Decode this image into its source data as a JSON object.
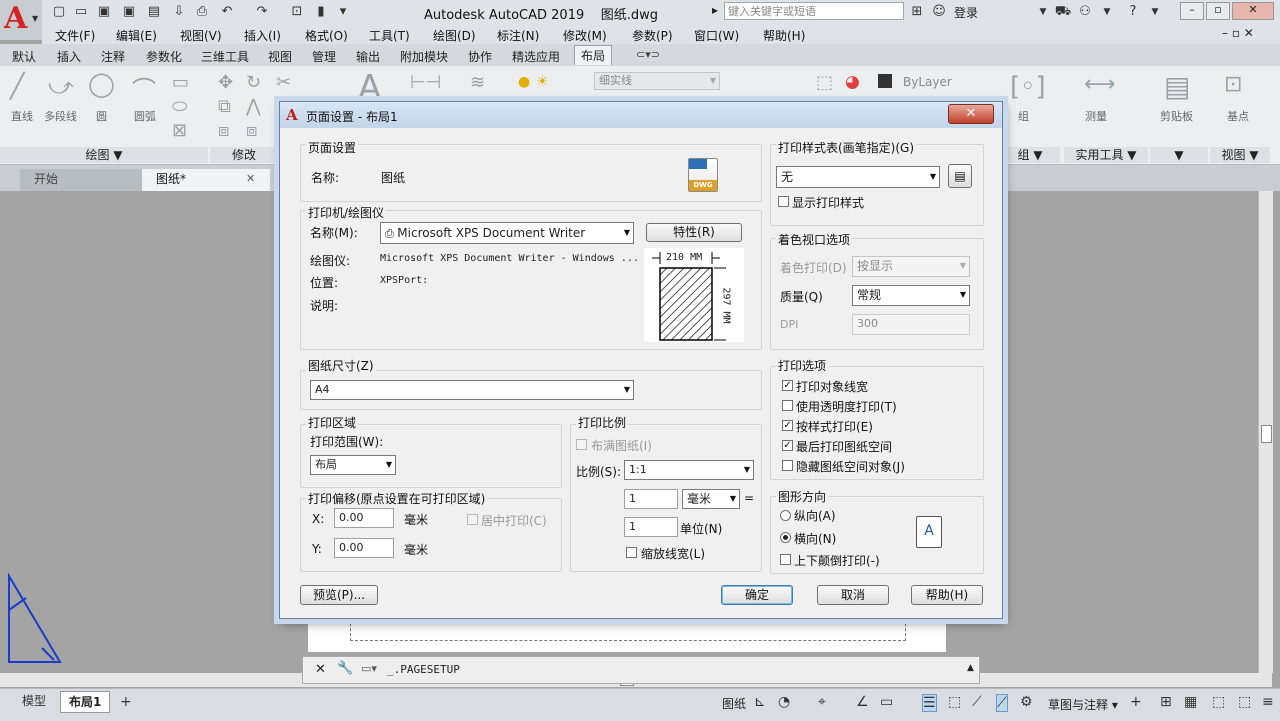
{
  "app": {
    "title": "Autodesk AutoCAD 2019",
    "filename": "图纸.dwg",
    "search_placeholder": "键入关键字或短语",
    "login_label": "登录"
  },
  "menus": [
    "文件(F)",
    "编辑(E)",
    "视图(V)",
    "插入(I)",
    "格式(O)",
    "工具(T)",
    "绘图(D)",
    "标注(N)",
    "修改(M)",
    "参数(P)",
    "窗口(W)",
    "帮助(H)"
  ],
  "ribbon_tabs": [
    "默认",
    "插入",
    "注释",
    "参数化",
    "三维工具",
    "视图",
    "管理",
    "输出",
    "附加模块",
    "协作",
    "精选应用",
    "布局"
  ],
  "active_ribbon_tab": "布局",
  "ribbon": {
    "tools": [
      "直线",
      "多段线",
      "圆",
      "圆弧"
    ],
    "panel_draw": "绘图",
    "panel_modify": "修改",
    "linetype": "细实线",
    "bylayer": "ByLayer",
    "group": "组",
    "measure": "测量",
    "clipboard": "剪贴板",
    "base": "基点",
    "panel_group": "组",
    "panel_utilities": "实用工具",
    "panel_view": "视图"
  },
  "doc_tabs": [
    {
      "label": "开始"
    },
    {
      "label": "图纸*"
    }
  ],
  "dialog": {
    "title": "页面设置 - 布局1",
    "page_setup": {
      "group": "页面设置",
      "name_label": "名称:",
      "name_value": "图纸",
      "dwg_icon_text": "DWG"
    },
    "printer": {
      "group": "打印机/绘图仪",
      "name_label": "名称(M):",
      "name_value": "Microsoft XPS Document Writer",
      "properties_button": "特性(R)",
      "plotter_label": "绘图仪:",
      "plotter_value": "Microsoft XPS Document Writer - Windows ...",
      "location_label": "位置:",
      "location_value": "XPSPort:",
      "description_label": "说明:",
      "preview_width": "210 MM",
      "preview_height": "297 MM"
    },
    "paper_size": {
      "group": "图纸尺寸(Z)",
      "value": "A4"
    },
    "plot_area": {
      "group": "打印区域",
      "range_label": "打印范围(W):",
      "range_value": "布局"
    },
    "plot_offset": {
      "group": "打印偏移(原点设置在可打印区域)",
      "x_label": "X:",
      "x_value": "0.00",
      "y_label": "Y:",
      "y_value": "0.00",
      "unit": "毫米",
      "center_label": "居中打印(C)"
    },
    "plot_scale": {
      "group": "打印比例",
      "fit_label": "布满图纸(I)",
      "scale_label": "比例(S):",
      "scale_value": "1:1",
      "num_value": "1",
      "unit_value": "毫米",
      "equals": "=",
      "den_value": "1",
      "units_label": "单位(N)",
      "scale_lineweights_label": "缩放线宽(L)"
    },
    "plot_style_table": {
      "group": "打印样式表(画笔指定)(G)",
      "value": "无",
      "display_label": "显示打印样式"
    },
    "shaded_viewport": {
      "group": "着色视口选项",
      "shade_label": "着色打印(D)",
      "shade_value": "按显示",
      "quality_label": "质量(Q)",
      "quality_value": "常规",
      "dpi_label": "DPI",
      "dpi_value": "300"
    },
    "plot_options": {
      "group": "打印选项",
      "items": [
        {
          "label": "打印对象线宽",
          "checked": true
        },
        {
          "label": "使用透明度打印(T)",
          "checked": false
        },
        {
          "label": "按样式打印(E)",
          "checked": true
        },
        {
          "label": "最后打印图纸空间",
          "checked": true
        },
        {
          "label": "隐藏图纸空间对象(J)",
          "checked": false
        }
      ]
    },
    "orientation": {
      "group": "图形方向",
      "portrait": "纵向(A)",
      "landscape": "横向(N)",
      "upside_down": "上下颠倒打印(-)",
      "selected": "landscape"
    },
    "buttons": {
      "preview": "预览(P)...",
      "ok": "确定",
      "cancel": "取消",
      "help": "帮助(H)"
    }
  },
  "command_line": {
    "text": "_.PAGESETUP"
  },
  "status": {
    "layout_tabs": [
      "模型",
      "布局1"
    ],
    "active": "布局1",
    "paper_label": "图纸",
    "workspace": "草图与注释"
  }
}
